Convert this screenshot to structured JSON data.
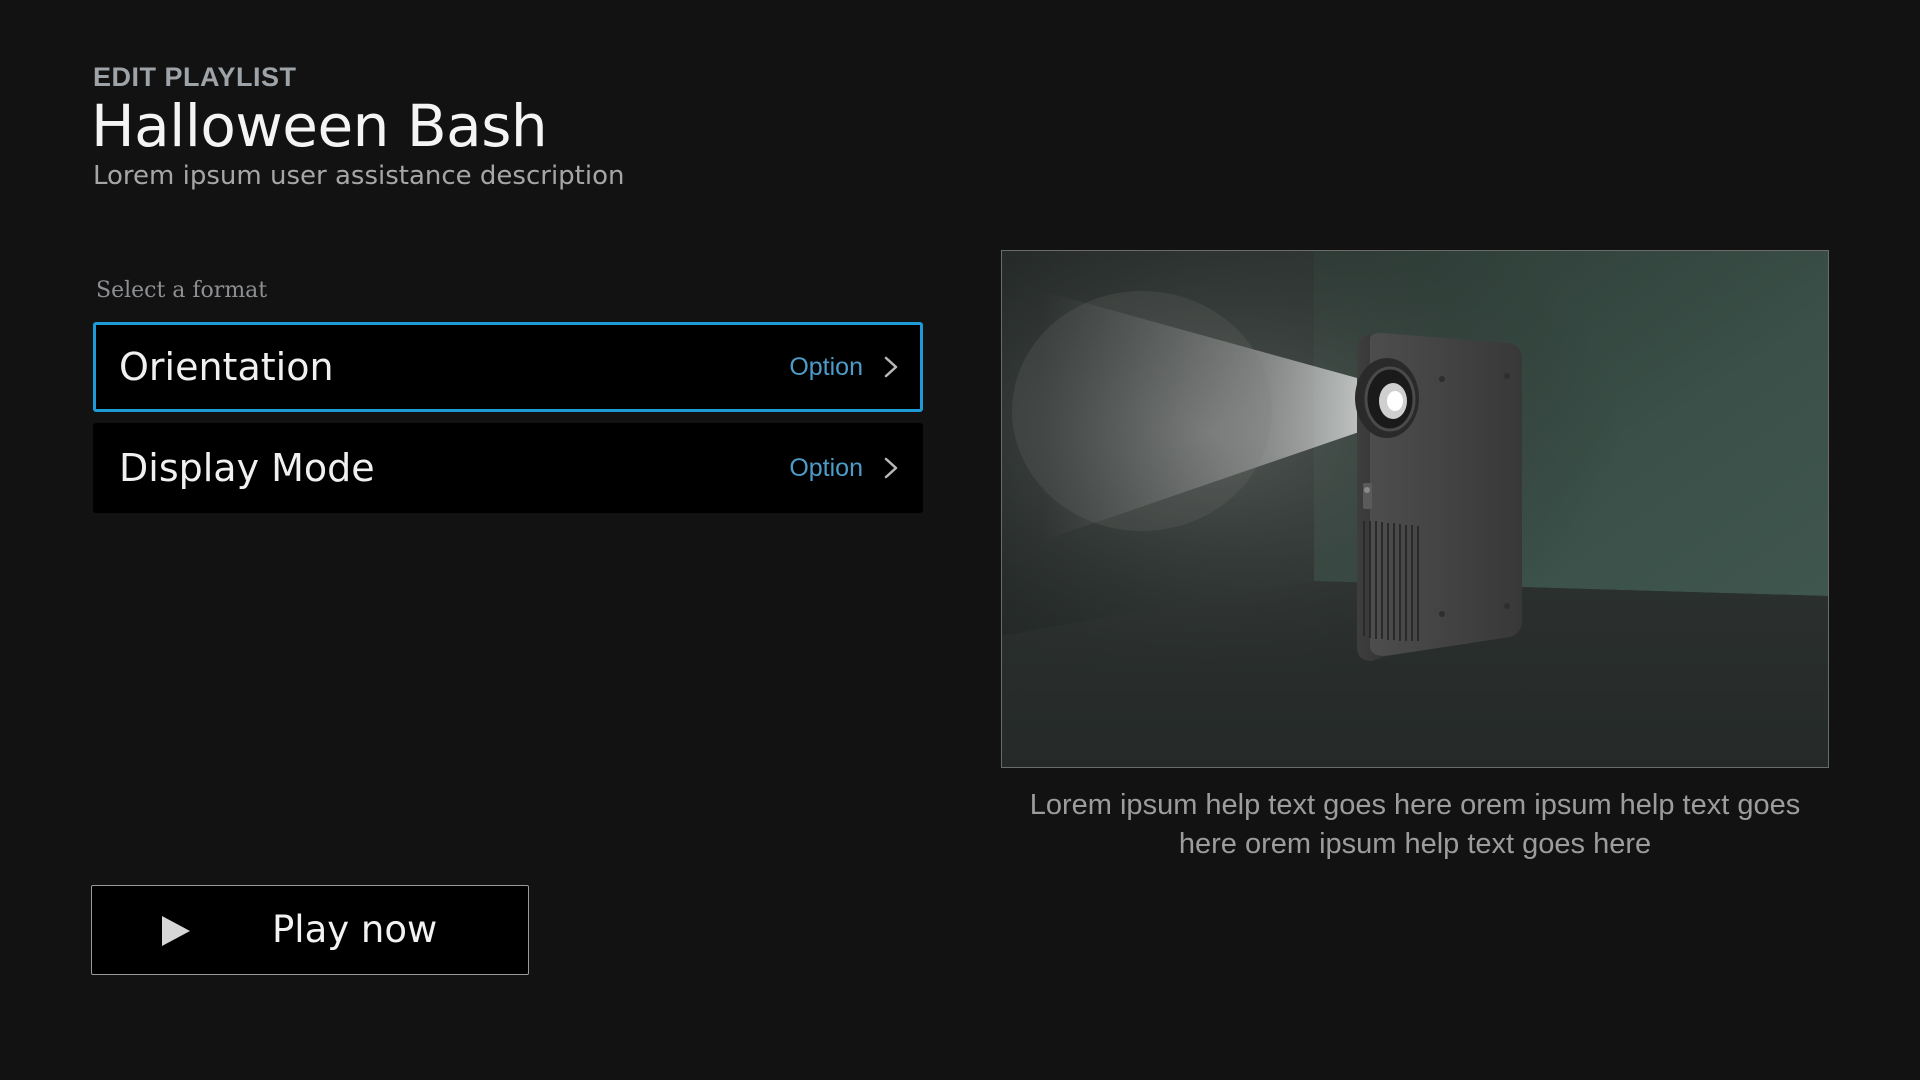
{
  "header": {
    "eyebrow": "EDIT PLAYLIST",
    "title": "Halloween Bash",
    "subtitle": "Lorem ipsum user assistance description"
  },
  "format": {
    "label": "Select a format",
    "items": [
      {
        "label": "Orientation",
        "value": "Option",
        "focused": true
      },
      {
        "label": "Display Mode",
        "value": "Option",
        "focused": false
      }
    ]
  },
  "preview": {
    "image": "projector-in-room-image"
  },
  "help_text": "Lorem ipsum help text goes here orem ipsum help text goes here orem ipsum help text goes here",
  "play_button": {
    "label": "Play now",
    "icon": "play-icon"
  },
  "colors": {
    "background": "#121212",
    "focus_border": "#1e9ad6",
    "option_value": "#4d9bc8"
  }
}
